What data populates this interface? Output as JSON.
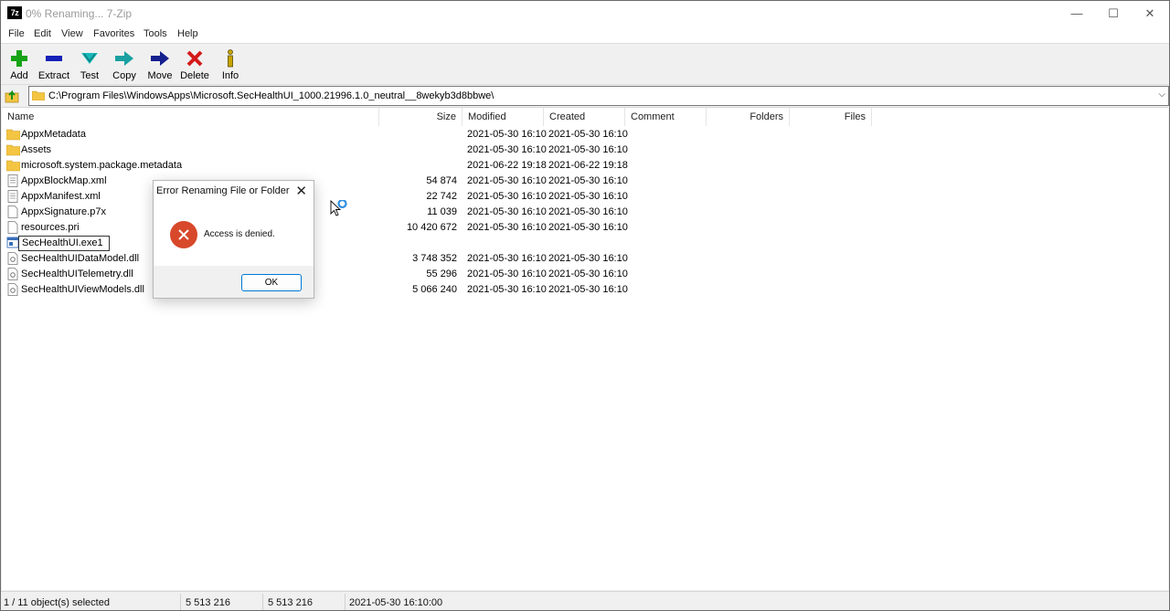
{
  "window": {
    "icon_text": "7z",
    "title": "0% Renaming... 7-Zip",
    "minimize": "—",
    "maximize": "☐",
    "close": "✕"
  },
  "menu": [
    "File",
    "Edit",
    "View",
    "Favorites",
    "Tools",
    "Help"
  ],
  "toolbar": {
    "add": "Add",
    "extract": "Extract",
    "test": "Test",
    "copy": "Copy",
    "move": "Move",
    "delete": "Delete",
    "info": "Info"
  },
  "address": {
    "path": "C:\\Program Files\\WindowsApps\\Microsoft.SecHealthUI_1000.21996.1.0_neutral__8wekyb3d8bbwe\\",
    "dropdown": "⌵"
  },
  "columns": {
    "name": "Name",
    "size": "Size",
    "modified": "Modified",
    "created": "Created",
    "comment": "Comment",
    "folders": "Folders",
    "files": "Files"
  },
  "rows": [
    {
      "name": "AppxMetadata",
      "type": "folder",
      "size": "",
      "modified": "2021-05-30 16:10",
      "created": "2021-05-30 16:10"
    },
    {
      "name": "Assets",
      "type": "folder",
      "size": "",
      "modified": "2021-05-30 16:10",
      "created": "2021-05-30 16:10"
    },
    {
      "name": "microsoft.system.package.metadata",
      "type": "folder",
      "size": "",
      "modified": "2021-06-22 19:18",
      "created": "2021-06-22 19:18"
    },
    {
      "name": "AppxBlockMap.xml",
      "type": "xml",
      "size": "54 874",
      "modified": "2021-05-30 16:10",
      "created": "2021-05-30 16:10"
    },
    {
      "name": "AppxManifest.xml",
      "type": "xml",
      "size": "22 742",
      "modified": "2021-05-30 16:10",
      "created": "2021-05-30 16:10"
    },
    {
      "name": "AppxSignature.p7x",
      "type": "file",
      "size": "11 039",
      "modified": "2021-05-30 16:10",
      "created": "2021-05-30 16:10"
    },
    {
      "name": "resources.pri",
      "type": "file",
      "size": "10 420 672",
      "modified": "2021-05-30 16:10",
      "created": "2021-05-30 16:10"
    },
    {
      "name": "SecHealthUI.exe1",
      "type": "exe",
      "size": "",
      "modified": "",
      "created": "",
      "editing": true
    },
    {
      "name": "SecHealthUIDataModel.dll",
      "type": "dll",
      "size": "3 748 352",
      "modified": "2021-05-30 16:10",
      "created": "2021-05-30 16:10"
    },
    {
      "name": "SecHealthUITelemetry.dll",
      "type": "dll",
      "size": "55 296",
      "modified": "2021-05-30 16:10",
      "created": "2021-05-30 16:10"
    },
    {
      "name": "SecHealthUIViewModels.dll",
      "type": "dll",
      "size": "5 066 240",
      "modified": "2021-05-30 16:10",
      "created": "2021-05-30 16:10"
    }
  ],
  "dialog": {
    "title": "Error Renaming File or Folder",
    "close": "✕",
    "message": "Access is denied.",
    "ok": "OK"
  },
  "status": {
    "selection": "1 / 11 object(s) selected",
    "size1": "5 513 216",
    "size2": "5 513 216",
    "date": "2021-05-30 16:10:00"
  },
  "colors": {
    "error_red": "#d8482b",
    "ok_border": "#0078d7",
    "folder_yellow": "#f4c542"
  }
}
